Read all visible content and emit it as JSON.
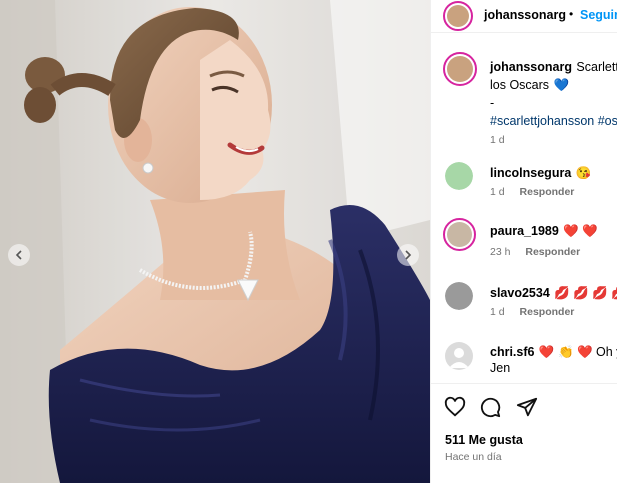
{
  "post": {
    "author": "johanssonarg",
    "follow_label": "Seguir",
    "caption_lines": [
      "Scarlett Johansson en",
      "los Oscars"
    ],
    "caption_heart": "💙",
    "caption_dash": "-",
    "hashtags": "#scarlettjohansson #oscars",
    "caption_time": "1 d"
  },
  "comments": [
    {
      "user": "lincolnsegura",
      "text": "😘",
      "time": "1 d",
      "reply": "Responder"
    },
    {
      "user": "paura_1989",
      "text": "❤️ ❤️",
      "time": "23 h",
      "reply": "Responder"
    },
    {
      "user": "slavo2534",
      "text": "💋 💋 💋 💋",
      "time": "1 d",
      "reply": "Responder"
    },
    {
      "user": "chri.sf6",
      "text": "❤️ 👏 ❤️ Oh yes",
      "text_line2": "Jen"
    }
  ],
  "footer": {
    "likes": "511 Me gusta",
    "when": "Hace un día"
  },
  "icons": {
    "like": "heart-outline-icon",
    "comment": "comment-bubble-icon",
    "share": "paper-plane-icon",
    "prev": "chevron-left-icon",
    "next": "chevron-right-icon"
  },
  "colors": {
    "link_blue": "#0095f6",
    "hashtag": "#00376b",
    "ring": "#d6249f"
  }
}
